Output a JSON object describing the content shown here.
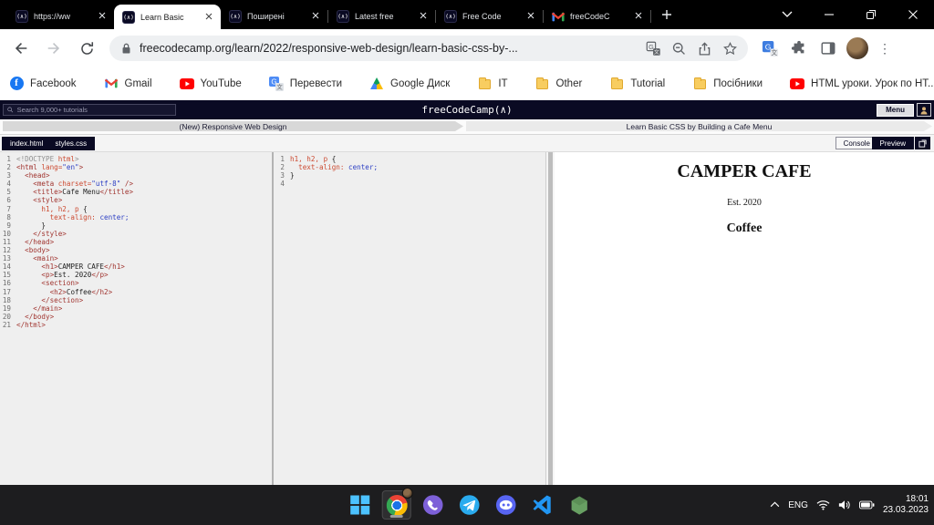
{
  "browser": {
    "tabs": [
      {
        "title": "https://ww",
        "favicon": "fcc",
        "active": false
      },
      {
        "title": "Learn Basic",
        "favicon": "fcc",
        "active": true
      },
      {
        "title": "Поширені",
        "favicon": "fcc",
        "active": false
      },
      {
        "title": "Latest free",
        "favicon": "fcc",
        "active": false
      },
      {
        "title": "Free Code",
        "favicon": "fcc",
        "active": false
      },
      {
        "title": "freeCodeC",
        "favicon": "gmail",
        "active": false
      }
    ],
    "url": "freecodecamp.org/learn/2022/responsive-web-design/learn-basic-css-by-...",
    "bookmarks": [
      {
        "label": "Facebook",
        "icon": "facebook"
      },
      {
        "label": "Gmail",
        "icon": "gmail"
      },
      {
        "label": "YouTube",
        "icon": "youtube"
      },
      {
        "label": "Перевести",
        "icon": "translate"
      },
      {
        "label": "Google Диск",
        "icon": "drive"
      },
      {
        "label": "IT",
        "icon": "folder"
      },
      {
        "label": "Other",
        "icon": "folder"
      },
      {
        "label": "Tutorial",
        "icon": "folder"
      },
      {
        "label": "Посібники",
        "icon": "folder"
      },
      {
        "label": "HTML уроки. Урок по НТ...",
        "icon": "youtube"
      }
    ],
    "bookmarks_overflow": "»"
  },
  "fcc": {
    "search_placeholder": "Search 9,000+ tutorials",
    "logo": "freeCodeCamp(∧)",
    "menu_label": "Menu",
    "breadcrumb_left": "(New) Responsive Web Design",
    "breadcrumb_right": "Learn Basic CSS by Building a Cafe Menu",
    "file_tabs": [
      "index.html",
      "styles.css"
    ],
    "console_label": "Console",
    "preview_label": "Preview"
  },
  "editor": {
    "html_lines": [
      {
        "n": 1,
        "toks": [
          [
            "g",
            "<!DOCTYPE "
          ],
          [
            "a",
            "html"
          ],
          [
            "g",
            ">"
          ]
        ]
      },
      {
        "n": 2,
        "toks": [
          [
            "t",
            "<html "
          ],
          [
            "a",
            "lang="
          ],
          [
            "s",
            "\"en\""
          ],
          [
            "t",
            ">"
          ]
        ]
      },
      {
        "n": 3,
        "toks": [
          [
            "t",
            "  <head>"
          ]
        ]
      },
      {
        "n": 4,
        "toks": [
          [
            "t",
            "    <meta "
          ],
          [
            "a",
            "charset="
          ],
          [
            "s",
            "\"utf-8\""
          ],
          [
            "t",
            " />"
          ]
        ]
      },
      {
        "n": 5,
        "toks": [
          [
            "t",
            "    <title>"
          ],
          [
            "x",
            "Cafe Menu"
          ],
          [
            "t",
            "</title>"
          ]
        ]
      },
      {
        "n": 6,
        "toks": [
          [
            "t",
            "    <style>"
          ]
        ]
      },
      {
        "n": 7,
        "toks": [
          [
            "a",
            "      h1, h2, p "
          ],
          [
            "x",
            "{"
          ]
        ]
      },
      {
        "n": 8,
        "toks": [
          [
            "a",
            "        text-align:"
          ],
          [
            "s",
            " center;"
          ]
        ]
      },
      {
        "n": 9,
        "toks": [
          [
            "x",
            "      }"
          ]
        ]
      },
      {
        "n": 10,
        "toks": [
          [
            "t",
            "    </style>"
          ]
        ]
      },
      {
        "n": 11,
        "toks": [
          [
            "t",
            "  </head>"
          ]
        ]
      },
      {
        "n": 12,
        "toks": [
          [
            "t",
            "  <body>"
          ]
        ]
      },
      {
        "n": 13,
        "toks": [
          [
            "t",
            "    <main>"
          ]
        ]
      },
      {
        "n": 14,
        "toks": [
          [
            "t",
            "      <h1>"
          ],
          [
            "x",
            "CAMPER CAFE"
          ],
          [
            "t",
            "</h1>"
          ]
        ]
      },
      {
        "n": 15,
        "toks": [
          [
            "t",
            "      <p>"
          ],
          [
            "x",
            "Est. 2020"
          ],
          [
            "t",
            "</p>"
          ]
        ]
      },
      {
        "n": 16,
        "toks": [
          [
            "t",
            "      <section>"
          ]
        ]
      },
      {
        "n": 17,
        "toks": [
          [
            "t",
            "        <h2>"
          ],
          [
            "x",
            "Coffee"
          ],
          [
            "t",
            "</h2>"
          ]
        ]
      },
      {
        "n": 18,
        "toks": [
          [
            "t",
            "      </section>"
          ]
        ]
      },
      {
        "n": 19,
        "toks": [
          [
            "t",
            "    </main>"
          ]
        ]
      },
      {
        "n": 20,
        "toks": [
          [
            "t",
            "  </body>"
          ]
        ]
      },
      {
        "n": 21,
        "toks": [
          [
            "t",
            "</html>"
          ]
        ]
      }
    ],
    "css_lines": [
      {
        "n": 1,
        "toks": [
          [
            "a",
            "h1, h2, p "
          ],
          [
            "x",
            "{"
          ]
        ]
      },
      {
        "n": 2,
        "toks": [
          [
            "a",
            "  text-align:"
          ],
          [
            "s",
            " center;"
          ]
        ]
      },
      {
        "n": 3,
        "toks": [
          [
            "x",
            "}"
          ]
        ]
      },
      {
        "n": 4,
        "toks": []
      }
    ]
  },
  "preview": {
    "title": "CAMPER CAFE",
    "subtitle": "Est. 2020",
    "section": "Coffee"
  },
  "taskbar": {
    "apps": [
      {
        "name": "start",
        "active": false
      },
      {
        "name": "chrome",
        "active": true
      },
      {
        "name": "viber",
        "active": false
      },
      {
        "name": "telegram",
        "active": false
      },
      {
        "name": "discord",
        "active": false
      },
      {
        "name": "vscode",
        "active": false
      },
      {
        "name": "node",
        "active": false
      }
    ],
    "tray": {
      "lang": "ENG",
      "time": "18:01",
      "date": "23.03.2023"
    }
  },
  "colors": {
    "fcc_navy": "#0a0a23",
    "titlebar_black": "#000000",
    "taskbar_dark": "#1d1d1f",
    "code_tag": "#a0342f",
    "code_attr": "#cc4a31",
    "code_string": "#2c3fc4"
  }
}
